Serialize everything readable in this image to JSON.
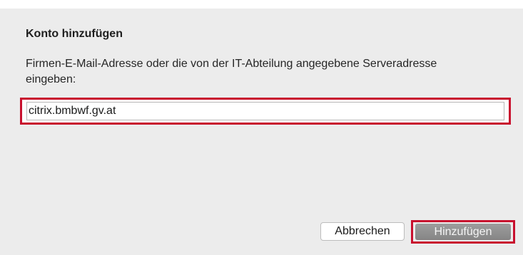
{
  "dialog": {
    "title": "Konto hinzufügen",
    "description": "Firmen-E-Mail-Adresse oder die von der IT-Abteilung angegebene Serveradresse eingeben:",
    "server_input": {
      "value": "citrix.bmbwf.gv.at"
    },
    "buttons": {
      "cancel_label": "Abbrechen",
      "add_label": "Hinzufügen"
    }
  },
  "colors": {
    "highlight": "#c8102e",
    "dialog_background": "#ececec",
    "add_button": "#8e8e8e"
  }
}
